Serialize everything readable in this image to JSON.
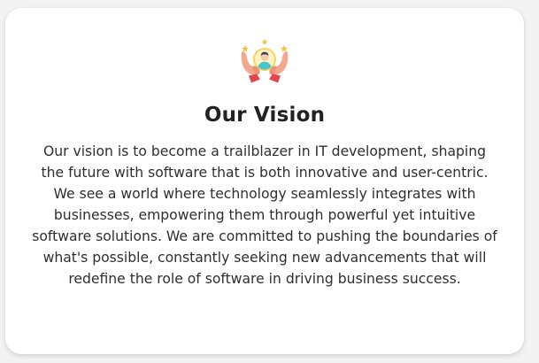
{
  "card": {
    "icon": "hands-holding-person-icon",
    "title": "Our Vision",
    "description": "Our vision is to become a trailblazer in IT development, shaping the future with software that is both innovative and user-centric. We see a world where technology seamlessly integrates with businesses, empowering them through powerful yet intuitive software solutions. We are committed to pushing the boundaries of what's possible, constantly seeking new advancements that will redefine the role of software in driving business success."
  },
  "colors": {
    "title": "#222222",
    "text": "#2f2f2f",
    "card_background": "#ffffff",
    "page_background": "#f3f3f3",
    "hands": "#f3a88e",
    "sleeves": "#e0464c",
    "stars": "#f6c23e",
    "avatar_ring": "#f5d65f"
  }
}
